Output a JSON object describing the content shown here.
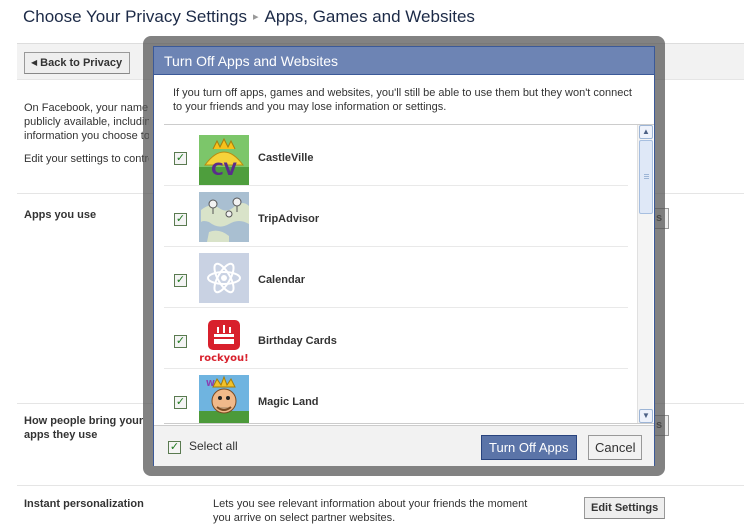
{
  "header": {
    "crumb_root": "Choose Your Privacy Settings",
    "crumb_sep": "▸",
    "crumb_current": "Apps, Games and Websites"
  },
  "toolbar": {
    "back_label": "Back to Privacy"
  },
  "background": {
    "intro_lines": [
      "On Facebook, your name, p",
      "publicly available, including",
      "information you choose to"
    ],
    "edit_line": "Edit your settings to contro",
    "apps_you_use": "Apps you use",
    "apps_btn_stub": "s",
    "how_people_line1": "How people bring your",
    "how_people_line2": "apps they use",
    "how_btn_stub": "s",
    "instant_label": "Instant personalization",
    "instant_desc_1": "Lets you see relevant information about your friends the moment",
    "instant_desc_2": "you arrive on select partner websites.",
    "edit_settings_label": "Edit Settings"
  },
  "dialog": {
    "title": "Turn Off Apps and Websites",
    "desc_line1": "If you turn off apps, games and websites, you'll still be able to use them but they won't connect",
    "desc_line2": "to your friends and you may lose information or settings.",
    "apps": [
      {
        "name": "CastleVille",
        "checked": true
      },
      {
        "name": "TripAdvisor",
        "checked": true
      },
      {
        "name": "Calendar",
        "checked": true
      },
      {
        "name": "Birthday Cards",
        "checked": true
      },
      {
        "name": "Magic Land",
        "checked": true
      }
    ],
    "select_all_label": "Select all",
    "turn_off_label": "Turn Off Apps",
    "cancel_label": "Cancel",
    "check_glyph": "✓",
    "birthday_brand": "rockyou!",
    "castleville_monogram": "CV"
  },
  "colors": {
    "dialog_title_bg": "#6d84b4",
    "primary_button": "#5b74a8",
    "link_text": "#1c2a47"
  }
}
